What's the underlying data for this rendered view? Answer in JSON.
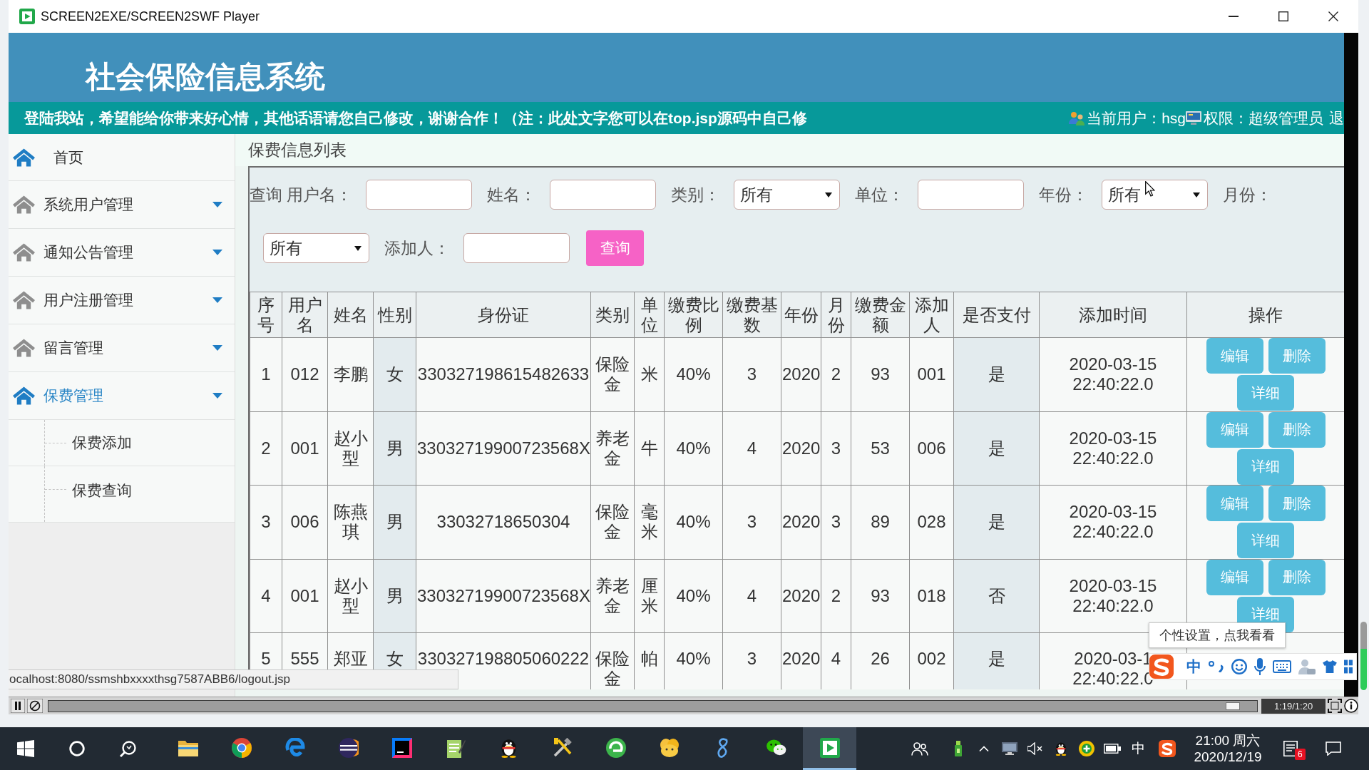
{
  "window": {
    "title": "SCREEN2EXE/SCREEN2SWF Player"
  },
  "header": {
    "title": "社会保险信息系统",
    "marquee": "登陆我站，希望能给你带来好心情，其他话语请您自己修改，谢谢合作！（注：此处文字您可以在top.jsp源码中自己修",
    "current_user": "当前用户：hsg",
    "role": "权限：超级管理员",
    "logout": "退"
  },
  "sidebar": {
    "items": [
      {
        "label": "首页",
        "kind": "link",
        "selected": false
      },
      {
        "label": "系统用户管理",
        "kind": "group",
        "selected": false
      },
      {
        "label": "通知公告管理",
        "kind": "group",
        "selected": false
      },
      {
        "label": "用户注册管理",
        "kind": "group",
        "selected": false
      },
      {
        "label": "留言管理",
        "kind": "group",
        "selected": false
      },
      {
        "label": "保费管理",
        "kind": "group",
        "selected": true,
        "children": [
          {
            "label": "保费添加",
            "selected": false
          },
          {
            "label": "保费查询",
            "selected": false
          }
        ]
      }
    ]
  },
  "content": {
    "title": "保费信息列表",
    "filters": [
      {
        "kind": "label",
        "text": "查询 用户名："
      },
      {
        "kind": "input"
      },
      {
        "kind": "label",
        "text": "姓名："
      },
      {
        "kind": "input"
      },
      {
        "kind": "label",
        "text": "类别："
      },
      {
        "kind": "select",
        "value": "所有"
      },
      {
        "kind": "label",
        "text": "单位："
      },
      {
        "kind": "input"
      },
      {
        "kind": "label",
        "text": "年份："
      },
      {
        "kind": "select",
        "value": "所有"
      },
      {
        "kind": "label",
        "text": "月份："
      },
      {
        "kind": "select",
        "value": "所有"
      },
      {
        "kind": "label",
        "text": "添加人："
      },
      {
        "kind": "input"
      }
    ],
    "search_button": "查询",
    "table": {
      "columns": [
        {
          "label": "序号",
          "highlighted": false
        },
        {
          "label": "用户名",
          "highlighted": false
        },
        {
          "label": "姓名",
          "highlighted": false
        },
        {
          "label": "性别",
          "highlighted": true
        },
        {
          "label": "身份证",
          "highlighted": false
        },
        {
          "label": "类别",
          "highlighted": false
        },
        {
          "label": "单位",
          "highlighted": false
        },
        {
          "label": "缴费比例",
          "highlighted": false
        },
        {
          "label": "缴费基数",
          "highlighted": false
        },
        {
          "label": "年份",
          "highlighted": false
        },
        {
          "label": "月份",
          "highlighted": false
        },
        {
          "label": "缴费金额",
          "highlighted": false
        },
        {
          "label": "添加人",
          "highlighted": false
        },
        {
          "label": "是否支付",
          "highlighted": true
        },
        {
          "label": "添加时间",
          "highlighted": false
        },
        {
          "label": "操作",
          "highlighted": false
        }
      ],
      "rows": [
        {
          "cells": [
            "1",
            "012",
            "李鹏",
            "女",
            "330327198615482633",
            "保险金",
            "米",
            "40%",
            "3",
            "2020",
            "2",
            "93",
            "001",
            "是",
            "2020-03-15 22:40:22.0"
          ],
          "actions": [
            "编辑",
            "删除",
            "详细"
          ],
          "clipped": false
        },
        {
          "cells": [
            "2",
            "001",
            "赵小型",
            "男",
            "33032719900723568X",
            "养老金",
            "牛",
            "40%",
            "4",
            "2020",
            "3",
            "53",
            "006",
            "是",
            "2020-03-15 22:40:22.0"
          ],
          "actions": [
            "编辑",
            "删除",
            "详细"
          ],
          "clipped": false
        },
        {
          "cells": [
            "3",
            "006",
            "陈燕琪",
            "男",
            "33032718650304",
            "保险金",
            "毫米",
            "40%",
            "3",
            "2020",
            "3",
            "89",
            "028",
            "是",
            "2020-03-15 22:40:22.0"
          ],
          "actions": [
            "编辑",
            "删除",
            "详细"
          ],
          "clipped": false
        },
        {
          "cells": [
            "4",
            "001",
            "赵小型",
            "男",
            "33032719900723568X",
            "养老金",
            "厘米",
            "40%",
            "4",
            "2020",
            "2",
            "93",
            "018",
            "否",
            "2020-03-15 22:40:22.0"
          ],
          "actions": [
            "编辑",
            "删除",
            "详细"
          ],
          "clipped": false
        },
        {
          "cells": [
            "5",
            "555",
            "郑亚",
            "女",
            "330327198805060222",
            "保险金",
            "帕",
            "40%",
            "3",
            "2020",
            "4",
            "26",
            "002",
            "是",
            "2020-03-1 22:40:22.0"
          ],
          "clipped": true
        }
      ]
    }
  },
  "status_tip": "ocalhost:8080/ssmshbxxxxthsg7587ABB6/logout.jsp",
  "ime": {
    "tooltip": "个性设置，点我看看",
    "mode": "中"
  },
  "player": {
    "level": 0.98,
    "time": "1:19/1:20"
  },
  "taskbar": {
    "apps": [
      {
        "selected": false
      },
      {
        "selected": false
      },
      {
        "selected": false
      },
      {
        "selected": false
      },
      {
        "selected": false
      },
      {
        "selected": false
      },
      {
        "selected": false
      },
      {
        "selected": false
      },
      {
        "selected": false
      },
      {
        "selected": false
      },
      {
        "selected": false
      },
      {
        "selected": false
      },
      {
        "selected": true
      }
    ],
    "input_mode": "中",
    "clock": {
      "time": "21:00 周六",
      "date": "2020/12/19"
    },
    "notification_count": "6"
  }
}
